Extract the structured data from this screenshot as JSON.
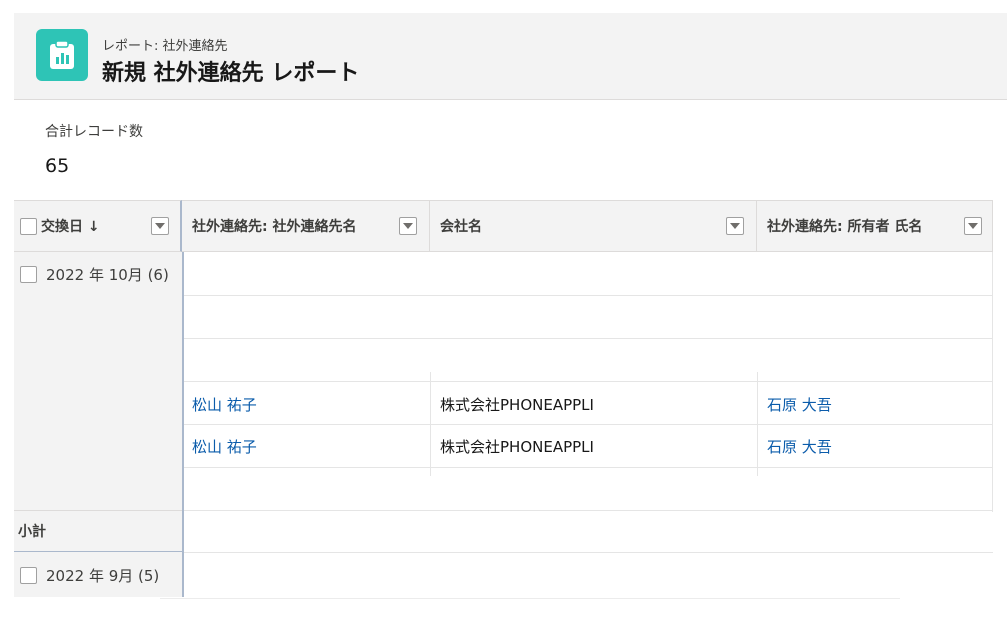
{
  "header": {
    "object_label": "レポート: 社外連絡先",
    "report_title": "新規 社外連絡先 レポート",
    "icon": "report-icon"
  },
  "record_count": {
    "label": "合計レコード数",
    "value": "65"
  },
  "columns": [
    {
      "label": "交換日 ↓"
    },
    {
      "label": "社外連絡先: 社外連絡先名"
    },
    {
      "label": "会社名"
    },
    {
      "label": "社外連絡先: 所有者 氏名"
    }
  ],
  "groups": [
    {
      "label": "2022 年 10月 (6)"
    },
    {
      "label": "2022 年 9月 (5)"
    }
  ],
  "rows": [
    {
      "contact_name": "松山 祐子",
      "company": "株式会社PHONEAPPLI",
      "owner": "石原 大吾"
    },
    {
      "contact_name": "松山 祐子",
      "company": "株式会社PHONEAPPLI",
      "owner": "石原 大吾"
    }
  ],
  "subtotal_label": "小計",
  "colors": {
    "accent": "#2ec4b6",
    "link": "#0b5cab",
    "header_bg": "#f3f3f3"
  }
}
